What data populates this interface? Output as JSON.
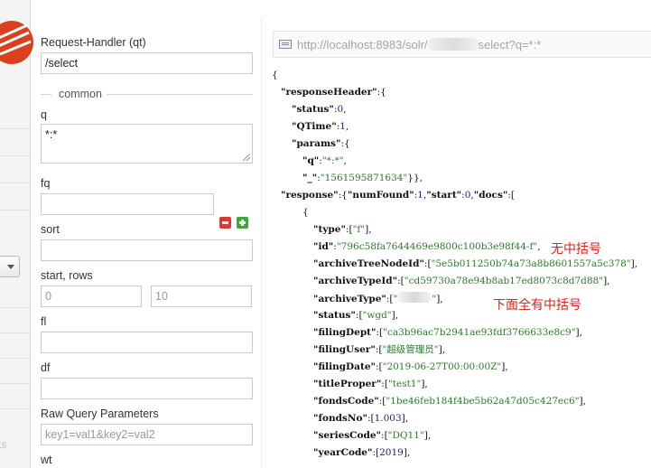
{
  "form": {
    "request_handler_label": "Request-Handler (qt)",
    "request_handler_value": "/select",
    "common_legend": "common",
    "q_label": "q",
    "q_value": "*:*",
    "fq_label": "fq",
    "fq_value": "",
    "sort_label": "sort",
    "sort_value": "",
    "start_rows_label": "start, rows",
    "start_placeholder": "0",
    "rows_placeholder": "10",
    "fl_label": "fl",
    "df_label": "df",
    "raw_label": "Raw Query Parameters",
    "raw_placeholder": "key1=val1&key2=val2",
    "wt_label": "wt"
  },
  "nav": {
    "partial_text": "ts"
  },
  "result": {
    "url_prefix": "http://localhost:8983/solr/",
    "url_suffix": "select?q=*:*",
    "json_lines": [
      {
        "parts": [
          {
            "t": "p",
            "v": "{"
          }
        ]
      },
      {
        "parts": [
          {
            "t": "k",
            "v": "\"responseHeader\""
          },
          {
            "t": "p",
            "v": ":{"
          }
        ]
      },
      {
        "parts": [
          {
            "t": "k",
            "v": "\"status\""
          },
          {
            "t": "p",
            "v": ":"
          },
          {
            "t": "n",
            "v": "0"
          },
          {
            "t": "p",
            "v": ","
          }
        ]
      },
      {
        "parts": [
          {
            "t": "k",
            "v": "\"QTime\""
          },
          {
            "t": "p",
            "v": ":"
          },
          {
            "t": "n",
            "v": "1"
          },
          {
            "t": "p",
            "v": ","
          }
        ]
      },
      {
        "parts": [
          {
            "t": "k",
            "v": "\"params\""
          },
          {
            "t": "p",
            "v": ":{"
          }
        ]
      },
      {
        "parts": [
          {
            "t": "k",
            "v": "\"q\""
          },
          {
            "t": "p",
            "v": ":"
          },
          {
            "t": "s",
            "v": "\"*:*\""
          },
          {
            "t": "p",
            "v": ","
          }
        ]
      },
      {
        "parts": [
          {
            "t": "k",
            "v": "\"_\""
          },
          {
            "t": "p",
            "v": ":"
          },
          {
            "t": "s",
            "v": "\"1561595871634\""
          },
          {
            "t": "p",
            "v": "}},"
          }
        ]
      },
      {
        "parts": [
          {
            "t": "k",
            "v": "\"response\""
          },
          {
            "t": "p",
            "v": ":{"
          },
          {
            "t": "k",
            "v": "\"numFound\""
          },
          {
            "t": "p",
            "v": ":"
          },
          {
            "t": "n",
            "v": "1"
          },
          {
            "t": "p",
            "v": ","
          },
          {
            "t": "k",
            "v": "\"start\""
          },
          {
            "t": "p",
            "v": ":"
          },
          {
            "t": "n",
            "v": "0"
          },
          {
            "t": "p",
            "v": ","
          },
          {
            "t": "k",
            "v": "\"docs\""
          },
          {
            "t": "p",
            "v": ":["
          }
        ]
      },
      {
        "parts": [
          {
            "t": "p",
            "v": "{"
          }
        ]
      },
      {
        "parts": [
          {
            "t": "k",
            "v": "\"type\""
          },
          {
            "t": "p",
            "v": ":["
          },
          {
            "t": "s",
            "v": "\"f\""
          },
          {
            "t": "p",
            "v": "],"
          }
        ]
      },
      {
        "parts": [
          {
            "t": "k",
            "v": "\"id\""
          },
          {
            "t": "p",
            "v": ":"
          },
          {
            "t": "s",
            "v": "\"796c58fa7644469e9800c100b3e98f44-f\""
          },
          {
            "t": "p",
            "v": ","
          }
        ]
      },
      {
        "parts": [
          {
            "t": "k",
            "v": "\"archiveTreeNodeId\""
          },
          {
            "t": "p",
            "v": ":["
          },
          {
            "t": "s",
            "v": "\"5e5b011250b74a73a8b8601557a5c378\""
          },
          {
            "t": "p",
            "v": "],"
          }
        ]
      },
      {
        "parts": [
          {
            "t": "k",
            "v": "\"archiveTypeId\""
          },
          {
            "t": "p",
            "v": ":["
          },
          {
            "t": "s",
            "v": "\"cd59730a78e94b8ab17ed8073c8d7d88\""
          },
          {
            "t": "p",
            "v": "],"
          }
        ]
      },
      {
        "parts": [
          {
            "t": "k",
            "v": "\"archiveType\""
          },
          {
            "t": "p",
            "v": ":["
          },
          {
            "t": "s",
            "v": "\""
          },
          {
            "t": "r",
            "v": ""
          },
          {
            "t": "s",
            "v": "\""
          },
          {
            "t": "p",
            "v": "],"
          }
        ]
      },
      {
        "parts": [
          {
            "t": "k",
            "v": "\"status\""
          },
          {
            "t": "p",
            "v": ":["
          },
          {
            "t": "s",
            "v": "\"wgd\""
          },
          {
            "t": "p",
            "v": "],"
          }
        ]
      },
      {
        "parts": [
          {
            "t": "k",
            "v": "\"filingDept\""
          },
          {
            "t": "p",
            "v": ":["
          },
          {
            "t": "s",
            "v": "\"ca3b96ac7b2941ae93fdf3766633e8c9\""
          },
          {
            "t": "p",
            "v": "],"
          }
        ]
      },
      {
        "parts": [
          {
            "t": "k",
            "v": "\"filingUser\""
          },
          {
            "t": "p",
            "v": ":["
          },
          {
            "t": "s",
            "v": "\"超级管理员\""
          },
          {
            "t": "p",
            "v": "],"
          }
        ]
      },
      {
        "parts": [
          {
            "t": "k",
            "v": "\"filingDate\""
          },
          {
            "t": "p",
            "v": ":["
          },
          {
            "t": "s",
            "v": "\"2019-06-27T00:00:00Z\""
          },
          {
            "t": "p",
            "v": "],"
          }
        ]
      },
      {
        "parts": [
          {
            "t": "k",
            "v": "\"titleProper\""
          },
          {
            "t": "p",
            "v": ":["
          },
          {
            "t": "s",
            "v": "\"test1\""
          },
          {
            "t": "p",
            "v": "],"
          }
        ]
      },
      {
        "parts": [
          {
            "t": "k",
            "v": "\"fondsCode\""
          },
          {
            "t": "p",
            "v": ":["
          },
          {
            "t": "s",
            "v": "\"1be46feb184f4be5b62a47d05c427ec6\""
          },
          {
            "t": "p",
            "v": "],"
          }
        ]
      },
      {
        "parts": [
          {
            "t": "k",
            "v": "\"fondsNo\""
          },
          {
            "t": "p",
            "v": ":["
          },
          {
            "t": "n",
            "v": "1.003"
          },
          {
            "t": "p",
            "v": "],"
          }
        ]
      },
      {
        "parts": [
          {
            "t": "k",
            "v": "\"seriesCode\""
          },
          {
            "t": "p",
            "v": ":["
          },
          {
            "t": "s",
            "v": "\"DQ11\""
          },
          {
            "t": "p",
            "v": "],"
          }
        ]
      },
      {
        "parts": [
          {
            "t": "k",
            "v": "\"yearCode\""
          },
          {
            "t": "p",
            "v": ":["
          },
          {
            "t": "n",
            "v": "2019"
          },
          {
            "t": "p",
            "v": "],"
          }
        ]
      }
    ],
    "annotation_no_brackets": "无中括号",
    "annotation_all_brackets": "下面全有中括号"
  },
  "colors": {
    "annotation": "#e0201b",
    "key": "#111111",
    "string": "#2a7a2a"
  }
}
